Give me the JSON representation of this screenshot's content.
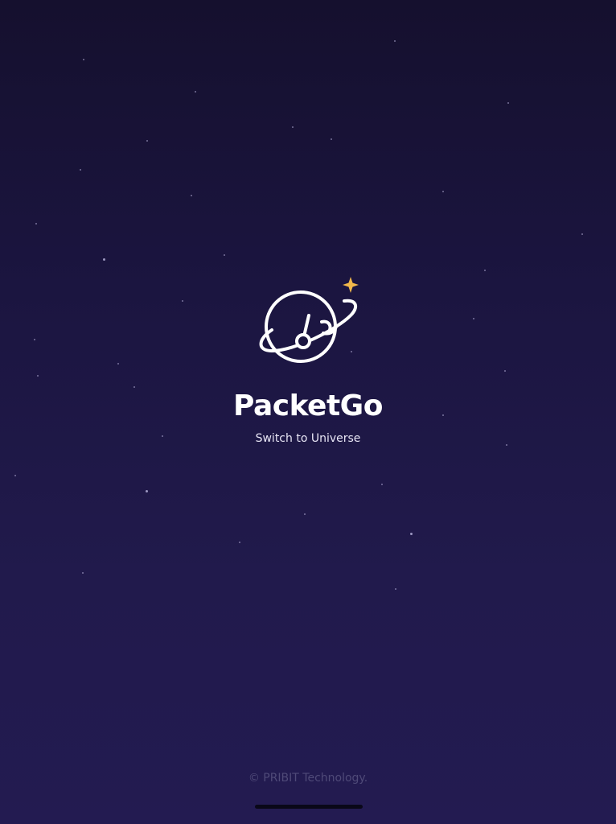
{
  "app": {
    "title": "PacketGo",
    "tagline": "Switch to Universe",
    "logo_icon": "planet-with-ring-icon",
    "sparkle_icon": "sparkle-star-icon"
  },
  "footer": {
    "copyright": "© PRIBIT Technology."
  },
  "colors": {
    "background_top": "#15102e",
    "background_bottom": "#231b51",
    "sparkle": "#f2b84b",
    "text_primary": "#ffffff",
    "footer_text": "#4f4a78"
  }
}
